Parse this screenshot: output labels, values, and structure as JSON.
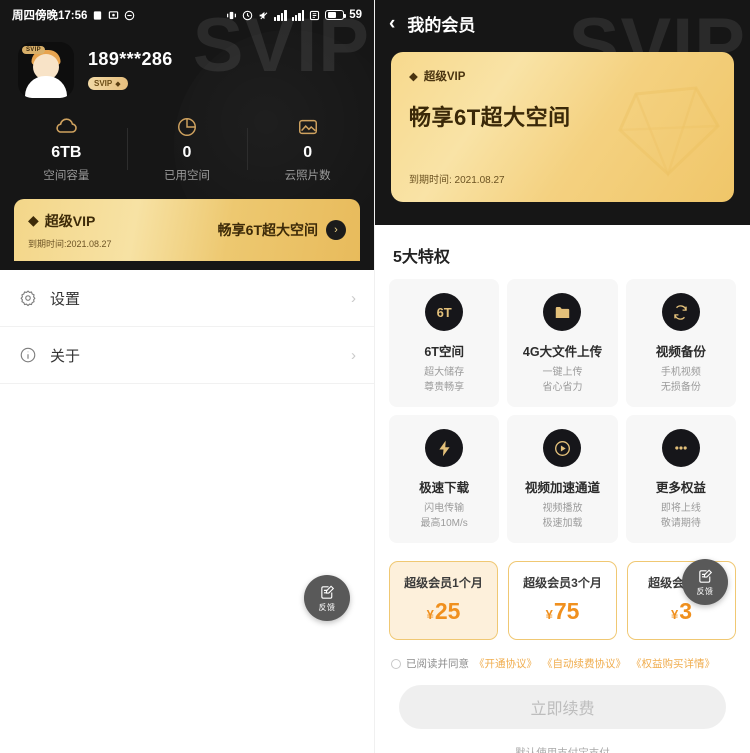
{
  "left": {
    "status_bar": {
      "time_text": "周四傍晚17:56",
      "battery_level": "59",
      "icons": [
        "screenshot-icon",
        "cast-icon",
        "alarm-icon",
        "dnd-icon",
        "clock-icon",
        "mute-icon",
        "signal-1-icon",
        "signal-2-icon",
        "sim-icon",
        "battery-icon"
      ]
    },
    "watermark": "SVIP",
    "profile": {
      "avatar_tag": "SVIP",
      "phone": "189***286",
      "badge": "SVIP"
    },
    "stats": [
      {
        "icon": "cloud-icon",
        "value": "6TB",
        "label": "空间容量"
      },
      {
        "icon": "pie-chart-icon",
        "value": "0",
        "label": "已用空间"
      },
      {
        "icon": "photo-icon",
        "value": "0",
        "label": "云照片数"
      }
    ],
    "vip_banner": {
      "title": "超级VIP",
      "expire": "到期时间:2021.08.27",
      "slogan": "畅享6T超大空间",
      "arrow": "›"
    },
    "menu": [
      {
        "icon": "gear-icon",
        "label": "设置",
        "chevron": "›"
      },
      {
        "icon": "info-icon",
        "label": "关于",
        "chevron": "›"
      }
    ],
    "fab": {
      "label": "反馈",
      "icon": "feedback-edit-icon"
    }
  },
  "right": {
    "nav": {
      "back": "‹",
      "title": "我的会员"
    },
    "watermark": "SVIP",
    "gold_card": {
      "tag": "超级VIP",
      "headline": "畅享6T超大空间",
      "expire": "到期时间: 2021.08.27"
    },
    "privileges_title": "5大特权",
    "privileges": [
      {
        "icon": "6t-badge-icon",
        "icon_text": "6T",
        "title": "6T空间",
        "d1": "超大储存",
        "d2": "尊贵畅享"
      },
      {
        "icon": "folder-upload-icon",
        "icon_text": "",
        "title": "4G大文件上传",
        "d1": "一键上传",
        "d2": "省心省力"
      },
      {
        "icon": "sync-backup-icon",
        "icon_text": "",
        "title": "视频备份",
        "d1": "手机视频",
        "d2": "无损备份"
      },
      {
        "icon": "lightning-icon",
        "icon_text": "",
        "title": "极速下载",
        "d1": "闪电传输",
        "d2": "最高10M/s"
      },
      {
        "icon": "play-icon",
        "icon_text": "",
        "title": "视频加速通道",
        "d1": "视频播放",
        "d2": "极速加载"
      },
      {
        "icon": "more-dots-icon",
        "icon_text": "",
        "title": "更多权益",
        "d1": "即将上线",
        "d2": "敬请期待"
      }
    ],
    "plans": [
      {
        "name": "超级会员1个月",
        "currency": "¥",
        "price": "25",
        "selected": true
      },
      {
        "name": "超级会员3个月",
        "currency": "¥",
        "price": "75",
        "selected": false
      },
      {
        "name": "超级会员1年",
        "currency": "¥",
        "price": "3",
        "selected": false
      }
    ],
    "agreement": {
      "prefix": "已阅读并同意",
      "link1": "《开通协议》",
      "link2": "《自动续费协议》",
      "link3": "《权益购买详情》"
    },
    "pay_button": "立即续费",
    "pay_note": "默认使用支付宝支付",
    "fab": {
      "label": "反馈",
      "icon": "feedback-edit-icon"
    }
  },
  "colors": {
    "gold": "#f0c873",
    "dark": "#161616",
    "orange": "#f0901e"
  }
}
